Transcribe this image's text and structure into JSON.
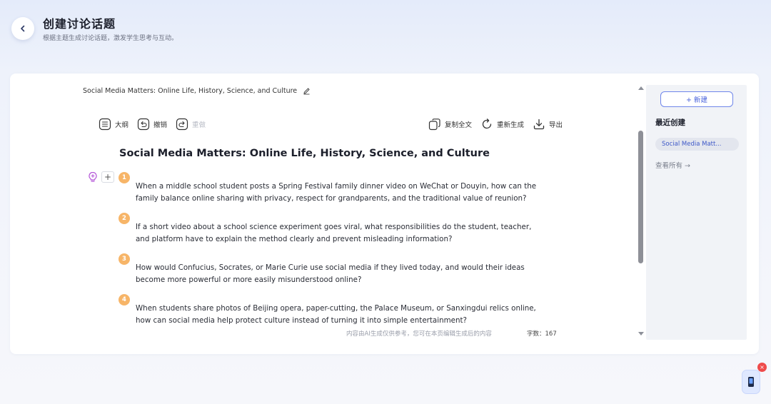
{
  "header": {
    "title": "创建讨论话题",
    "subtitle": "根据主题生成讨论话题，激发学生思考与互动。"
  },
  "document": {
    "name": "Social Media Matters: Online Life, History, Science, and Culture"
  },
  "toolbar": {
    "outline_label": "大纲",
    "undo_label": "撤销",
    "redo_label": "重做",
    "copy_label": "复制全文",
    "regenerate_label": "重新生成",
    "export_label": "导出"
  },
  "content": {
    "title": "Social Media Matters: Online Life, History, Science, and Culture",
    "questions": [
      {
        "num": "1",
        "text": "When a middle school student posts a Spring Festival family dinner video on WeChat or Douyin, how can the family balance online sharing with privacy, respect for grandparents, and the traditional value of reunion?"
      },
      {
        "num": "2",
        "text": "If a short video about a school science experiment goes viral, what responsibilities do the student, teacher, and platform have to explain the method clearly and prevent misleading information?"
      },
      {
        "num": "3",
        "text": "How would Confucius, Socrates, or Marie Curie use social media if they lived today, and would their ideas become more powerful or more easily misunderstood online?"
      },
      {
        "num": "4",
        "text": "When students share photos of Beijing opera, paper-cutting, the Palace Museum, or Sanxingdui relics online, how can social media help protect culture instead of turning it into simple entertainment?"
      }
    ]
  },
  "footer": {
    "note": "内容由AI生成仅供参考，您可在本页编辑生成后的内容",
    "word_count": "字数：167"
  },
  "sidebar": {
    "new_label": "+ 新建",
    "recent_title": "最近创建",
    "recent_items": [
      "Social Media Matt..."
    ],
    "view_all_label": "查看所有 →"
  },
  "colors": {
    "accent": "#4a63dc",
    "number_badge": "#f7b568",
    "close_badge": "#ef4b4b"
  }
}
